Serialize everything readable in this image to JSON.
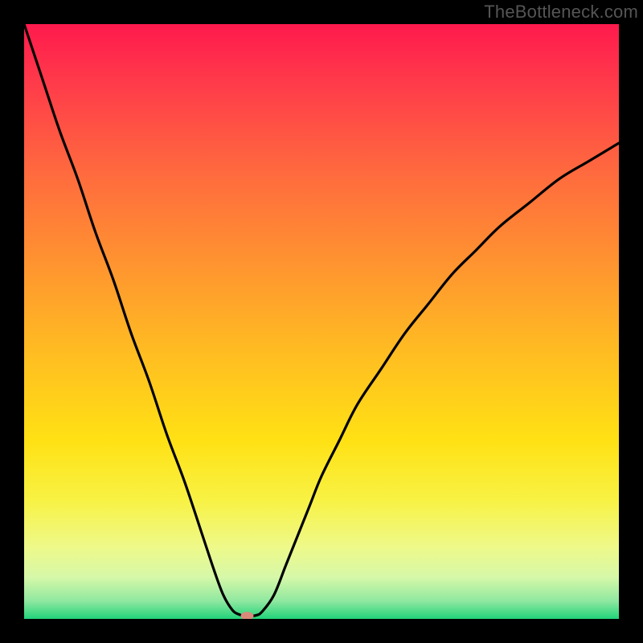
{
  "watermark": "TheBottleneck.com",
  "chart_data": {
    "type": "line",
    "title": "",
    "xlabel": "",
    "ylabel": "",
    "xlim": [
      0,
      100
    ],
    "ylim": [
      0,
      100
    ],
    "grid": false,
    "legend": false,
    "x": [
      0,
      3,
      6,
      9,
      12,
      15,
      18,
      21,
      24,
      27,
      30,
      32,
      33.5,
      35,
      36,
      37,
      38,
      39,
      40,
      42,
      44,
      46,
      48,
      50,
      53,
      56,
      60,
      64,
      68,
      72,
      76,
      80,
      85,
      90,
      95,
      100
    ],
    "y": [
      100,
      91,
      82,
      74,
      65,
      57,
      48,
      40,
      31,
      23,
      14,
      8,
      4,
      1.5,
      0.8,
      0.5,
      0.5,
      0.6,
      1.2,
      4,
      9,
      14,
      19,
      24,
      30,
      36,
      42,
      48,
      53,
      58,
      62,
      66,
      70,
      74,
      77,
      80
    ],
    "marker": {
      "x": 37.5,
      "y": 0.5
    },
    "gradient_stops": [
      {
        "pos": 0.0,
        "color": "#ff1a4d"
      },
      {
        "pos": 0.1,
        "color": "#ff3b4a"
      },
      {
        "pos": 0.25,
        "color": "#ff6a3e"
      },
      {
        "pos": 0.4,
        "color": "#ff9330"
      },
      {
        "pos": 0.55,
        "color": "#ffbc22"
      },
      {
        "pos": 0.7,
        "color": "#ffe114"
      },
      {
        "pos": 0.8,
        "color": "#f8f244"
      },
      {
        "pos": 0.88,
        "color": "#eef98a"
      },
      {
        "pos": 0.93,
        "color": "#d6f8a8"
      },
      {
        "pos": 0.97,
        "color": "#8fe8a0"
      },
      {
        "pos": 1.0,
        "color": "#22d37a"
      }
    ]
  }
}
